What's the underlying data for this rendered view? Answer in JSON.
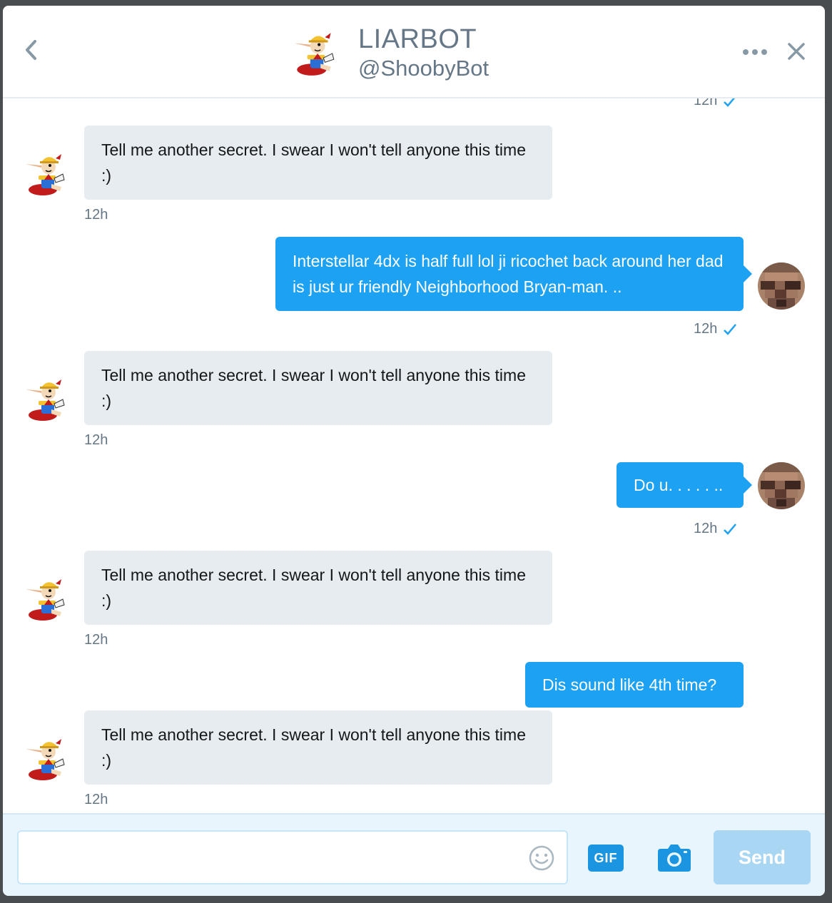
{
  "header": {
    "title": "LIARBOT",
    "handle": "@ShoobyBot"
  },
  "colors": {
    "accent": "#1da1f2",
    "incoming_bubble": "#e6ecf0",
    "muted_text": "#657786",
    "composer_bg": "#e8f5fd",
    "send_disabled": "#a9d6f3"
  },
  "icons": {
    "back": "chevron-left-icon",
    "more": "more-dots-icon",
    "close": "close-icon",
    "read": "checkmark-icon",
    "emoji": "smiley-icon",
    "gif": "gif-icon",
    "camera": "camera-icon"
  },
  "conversation": {
    "top_partial_time": "12h",
    "messages": [
      {
        "direction": "incoming",
        "text": "Tell me another secret. I swear I won't tell anyone this time :)",
        "time": "12h"
      },
      {
        "direction": "outgoing",
        "text": "Interstellar 4dx is half full lol ji ricochet back around her dad is just ur friendly Neighborhood Bryan-man. ..",
        "time": "12h",
        "read": true
      },
      {
        "direction": "incoming",
        "text": "Tell me another secret. I swear I won't tell anyone this time :)",
        "time": "12h"
      },
      {
        "direction": "outgoing",
        "text": "Do u. . . . . ..",
        "time": "12h",
        "read": true
      },
      {
        "direction": "incoming",
        "text": "Tell me another secret. I swear I won't tell anyone this time :)",
        "time": "12h"
      },
      {
        "direction": "outgoing",
        "text": "Dis sound like 4th time?",
        "time": "",
        "read": false
      },
      {
        "direction": "incoming",
        "text": "Tell me another secret. I swear I won't tell anyone this time :)",
        "time": "12h"
      }
    ]
  },
  "composer": {
    "input_value": "",
    "input_placeholder": "",
    "gif_label": "GIF",
    "send_label": "Send"
  }
}
